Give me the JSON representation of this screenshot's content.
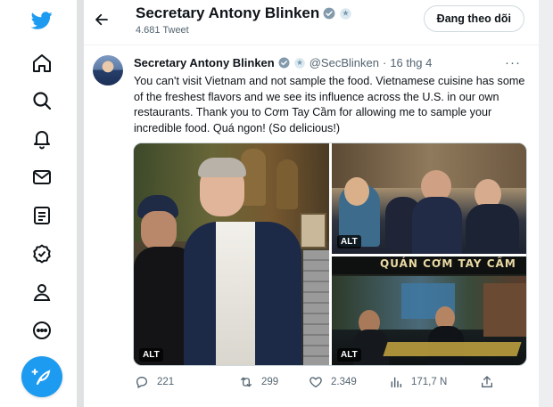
{
  "nav": {
    "items": [
      "twitter-logo",
      "home-icon",
      "explore-icon",
      "notifications-icon",
      "messages-icon",
      "lists-icon",
      "verified-icon",
      "profile-icon",
      "more-icon"
    ],
    "accent": "#1d9bf0"
  },
  "header": {
    "title": "Secretary Antony Blinken",
    "subtitle": "4.681 Tweet",
    "follow_label": "Đang theo dõi"
  },
  "tweet": {
    "name": "Secretary Antony Blinken",
    "handle": "@SecBlinken",
    "dot": "·",
    "date": "16 thg 4",
    "text": "You can't visit Vietnam and not sample the food. Vietnamese cuisine has some of the freshest flavors and we see its influence across the U.S. in our own restaurants. Thank you to Cơm Tay Cầm for allowing me to sample your incredible food. Quá ngon! (So delicious!)",
    "more_label": "···",
    "media": {
      "alt_label": "ALT",
      "sign_text": "QUÁN CƠM TAY CẦM"
    },
    "stats": {
      "replies": "221",
      "retweets": "299",
      "likes": "2.349",
      "views": "171,7 N"
    }
  }
}
